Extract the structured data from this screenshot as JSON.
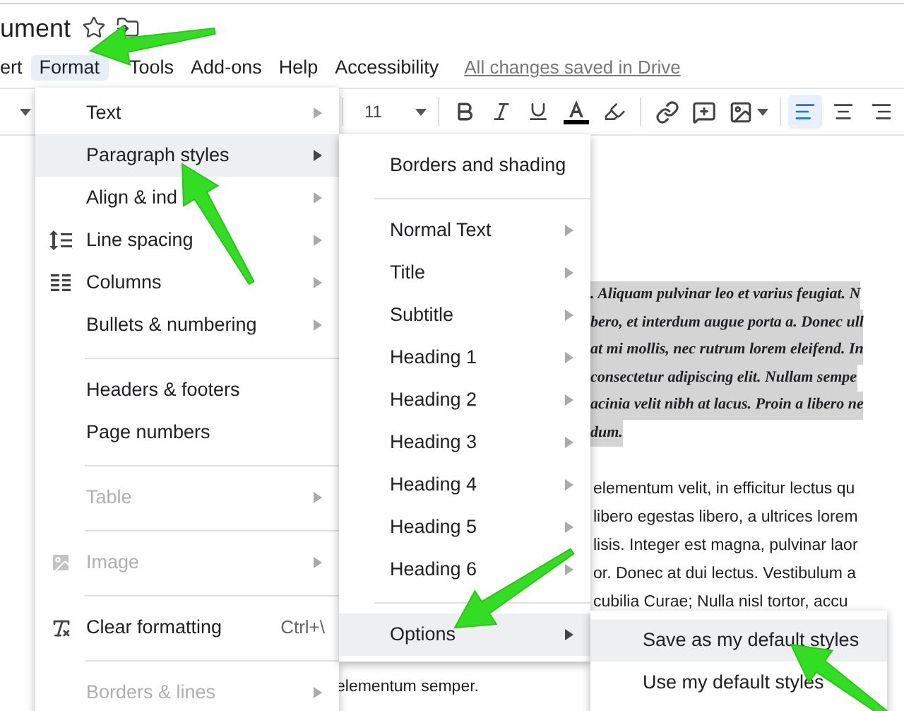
{
  "title": "ument",
  "menu_bar": [
    {
      "label": "ert",
      "selected": false
    },
    {
      "label": "Format",
      "selected": true
    },
    {
      "label": "Tools",
      "selected": false
    },
    {
      "label": "Add-ons",
      "selected": false
    },
    {
      "label": "Help",
      "selected": false
    },
    {
      "label": "Accessibility",
      "selected": false
    }
  ],
  "save_status": "All changes saved in Drive",
  "toolbar": {
    "font_size": "11",
    "align_buttons": [
      {
        "selected": true
      },
      {
        "selected": false
      },
      {
        "selected": false
      }
    ]
  },
  "format_menu": {
    "sections": [
      [
        {
          "label": "Text",
          "kind": "item",
          "submenu": true,
          "disabled": false,
          "selected": false
        },
        {
          "label": "Paragraph styles",
          "kind": "item",
          "submenu": true,
          "disabled": false,
          "selected": true
        },
        {
          "label": "Align & ind",
          "kind": "item",
          "submenu": true,
          "disabled": false,
          "selected": false
        },
        {
          "label": "Line spacing",
          "kind": "line-spacing",
          "submenu": true,
          "disabled": false,
          "selected": false
        },
        {
          "label": "Columns",
          "kind": "columns",
          "submenu": true,
          "disabled": false,
          "selected": false
        },
        {
          "label": "Bullets & numbering",
          "kind": "item",
          "submenu": true,
          "disabled": false,
          "selected": false
        }
      ],
      [
        {
          "label": "Headers & footers",
          "kind": "item",
          "submenu": false,
          "disabled": false,
          "selected": false
        },
        {
          "label": "Page numbers",
          "kind": "item",
          "submenu": false,
          "disabled": false,
          "selected": false
        }
      ],
      [
        {
          "label": "Table",
          "kind": "item",
          "submenu": true,
          "disabled": true,
          "selected": false
        }
      ],
      [
        {
          "label": "Image",
          "kind": "image",
          "submenu": true,
          "disabled": true,
          "selected": false
        }
      ],
      [
        {
          "label": "Clear formatting",
          "kind": "clear",
          "shortcut": "Ctrl+\\",
          "submenu": false,
          "disabled": false,
          "selected": false
        }
      ],
      [
        {
          "label": "Borders & lines",
          "kind": "item",
          "submenu": true,
          "disabled": true,
          "selected": false
        }
      ]
    ]
  },
  "paragraph_styles_menu": {
    "sections": [
      [
        {
          "label": "Borders and shading",
          "submenu": false,
          "selected": false
        }
      ],
      [
        {
          "label": "Normal Text",
          "submenu": true,
          "selected": false
        },
        {
          "label": "Title",
          "submenu": true,
          "selected": false
        },
        {
          "label": "Subtitle",
          "submenu": true,
          "selected": false
        },
        {
          "label": "Heading 1",
          "submenu": true,
          "selected": false
        },
        {
          "label": "Heading 2",
          "submenu": true,
          "selected": false
        },
        {
          "label": "Heading 3",
          "submenu": true,
          "selected": false
        },
        {
          "label": "Heading 4",
          "submenu": true,
          "selected": false
        },
        {
          "label": "Heading 5",
          "submenu": true,
          "selected": false
        },
        {
          "label": "Heading 6",
          "submenu": true,
          "selected": false
        }
      ],
      [
        {
          "label": "Options",
          "submenu": true,
          "selected": true
        }
      ]
    ]
  },
  "options_menu": [
    {
      "label": "Save as my default styles",
      "selected": true
    },
    {
      "label": "Use my default styles",
      "selected": false
    }
  ],
  "document": {
    "highlighted_lines": [
      ". Aliquam pulvinar leo et varius feugiat. N",
      "bero, et interdum augue porta a. Donec ull",
      "at mi mollis, nec rutrum lorem eleifend. In",
      "consectetur adipiscing elit. Nullam sempe",
      "acinia velit nibh at lacus. Proin a libero ne",
      "dum."
    ],
    "lines": [
      "elementum velit, in efficitur lectus qu",
      "libero egestas libero, a ultrices lorem",
      "lisis. Integer est magna, pulvinar laor",
      "or. Donec at dui lectus. Vestibulum a",
      "cubilia Curae; Nulla nisl tortor, accu"
    ],
    "last_line": "elementum semper."
  }
}
